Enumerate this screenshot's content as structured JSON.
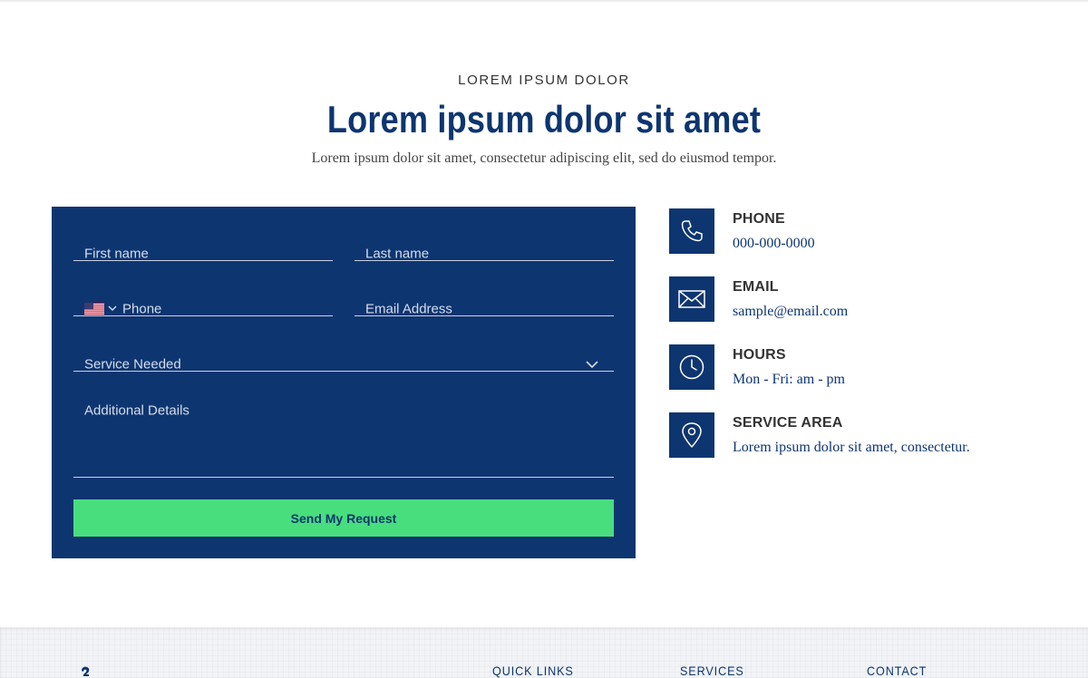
{
  "header": {
    "eyebrow": "LOREM IPSUM DOLOR",
    "title": "Lorem ipsum dolor sit amet",
    "subtitle": "Lorem ipsum dolor sit amet, consectetur adipiscing elit, sed do eiusmod tempor."
  },
  "form": {
    "first_name_placeholder": "First name",
    "last_name_placeholder": "Last name",
    "phone_placeholder": "Phone",
    "email_placeholder": "Email Address",
    "service_placeholder": "Service Needed",
    "details_placeholder": "Additional Details",
    "submit_label": "Send My Request"
  },
  "contact_info": {
    "phone": {
      "label": "PHONE",
      "value": "000-000-0000",
      "icon": "phone-icon"
    },
    "email": {
      "label": "EMAIL",
      "value": "sample@email.com",
      "icon": "envelope-icon"
    },
    "hours": {
      "label": "HOURS",
      "value": "Mon - Fri: am - pm",
      "icon": "clock-icon"
    },
    "area": {
      "label": "SERVICE AREA",
      "value": "Lorem ipsum dolor sit amet, consectetur.",
      "icon": "map-pin-icon"
    }
  },
  "footer": {
    "quick_links": "QUICK LINKS",
    "services": "SERVICES",
    "contact": "CONTACT"
  },
  "colors": {
    "primary": "#0d3570",
    "accent": "#48de7e",
    "footer_bg": "#f1f3f6"
  }
}
